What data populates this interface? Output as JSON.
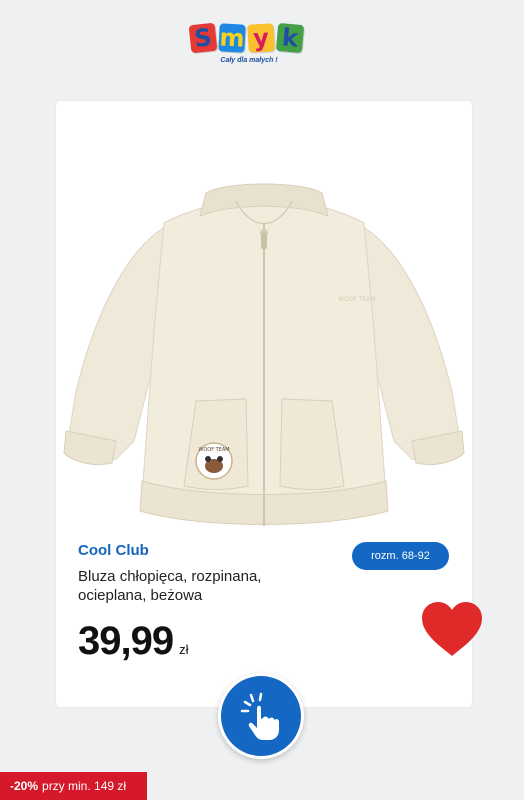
{
  "logo": {
    "letters": [
      "S",
      "m",
      "y",
      "k"
    ],
    "tagline": "Cały dla małych !"
  },
  "product": {
    "brand": "Cool Club",
    "name": "Bluza chłopięca, rozpinana, ocieplana, beżowa",
    "size_badge": "rozm. 68-92",
    "price": "39,99",
    "currency": "zł",
    "image_description_icon": "jacket-image",
    "patch_text": "WOOF TEAM"
  },
  "actions": {
    "favorite_icon": "heart-icon",
    "tap_icon": "tap-hand-icon"
  },
  "promo": {
    "discount": "-20%",
    "condition": "przy min. 149 zł"
  },
  "colors": {
    "accent_blue": "#1468c4",
    "heart_red": "#e02a2a",
    "promo_red": "#d6192a",
    "garment": "#efe9d9"
  }
}
